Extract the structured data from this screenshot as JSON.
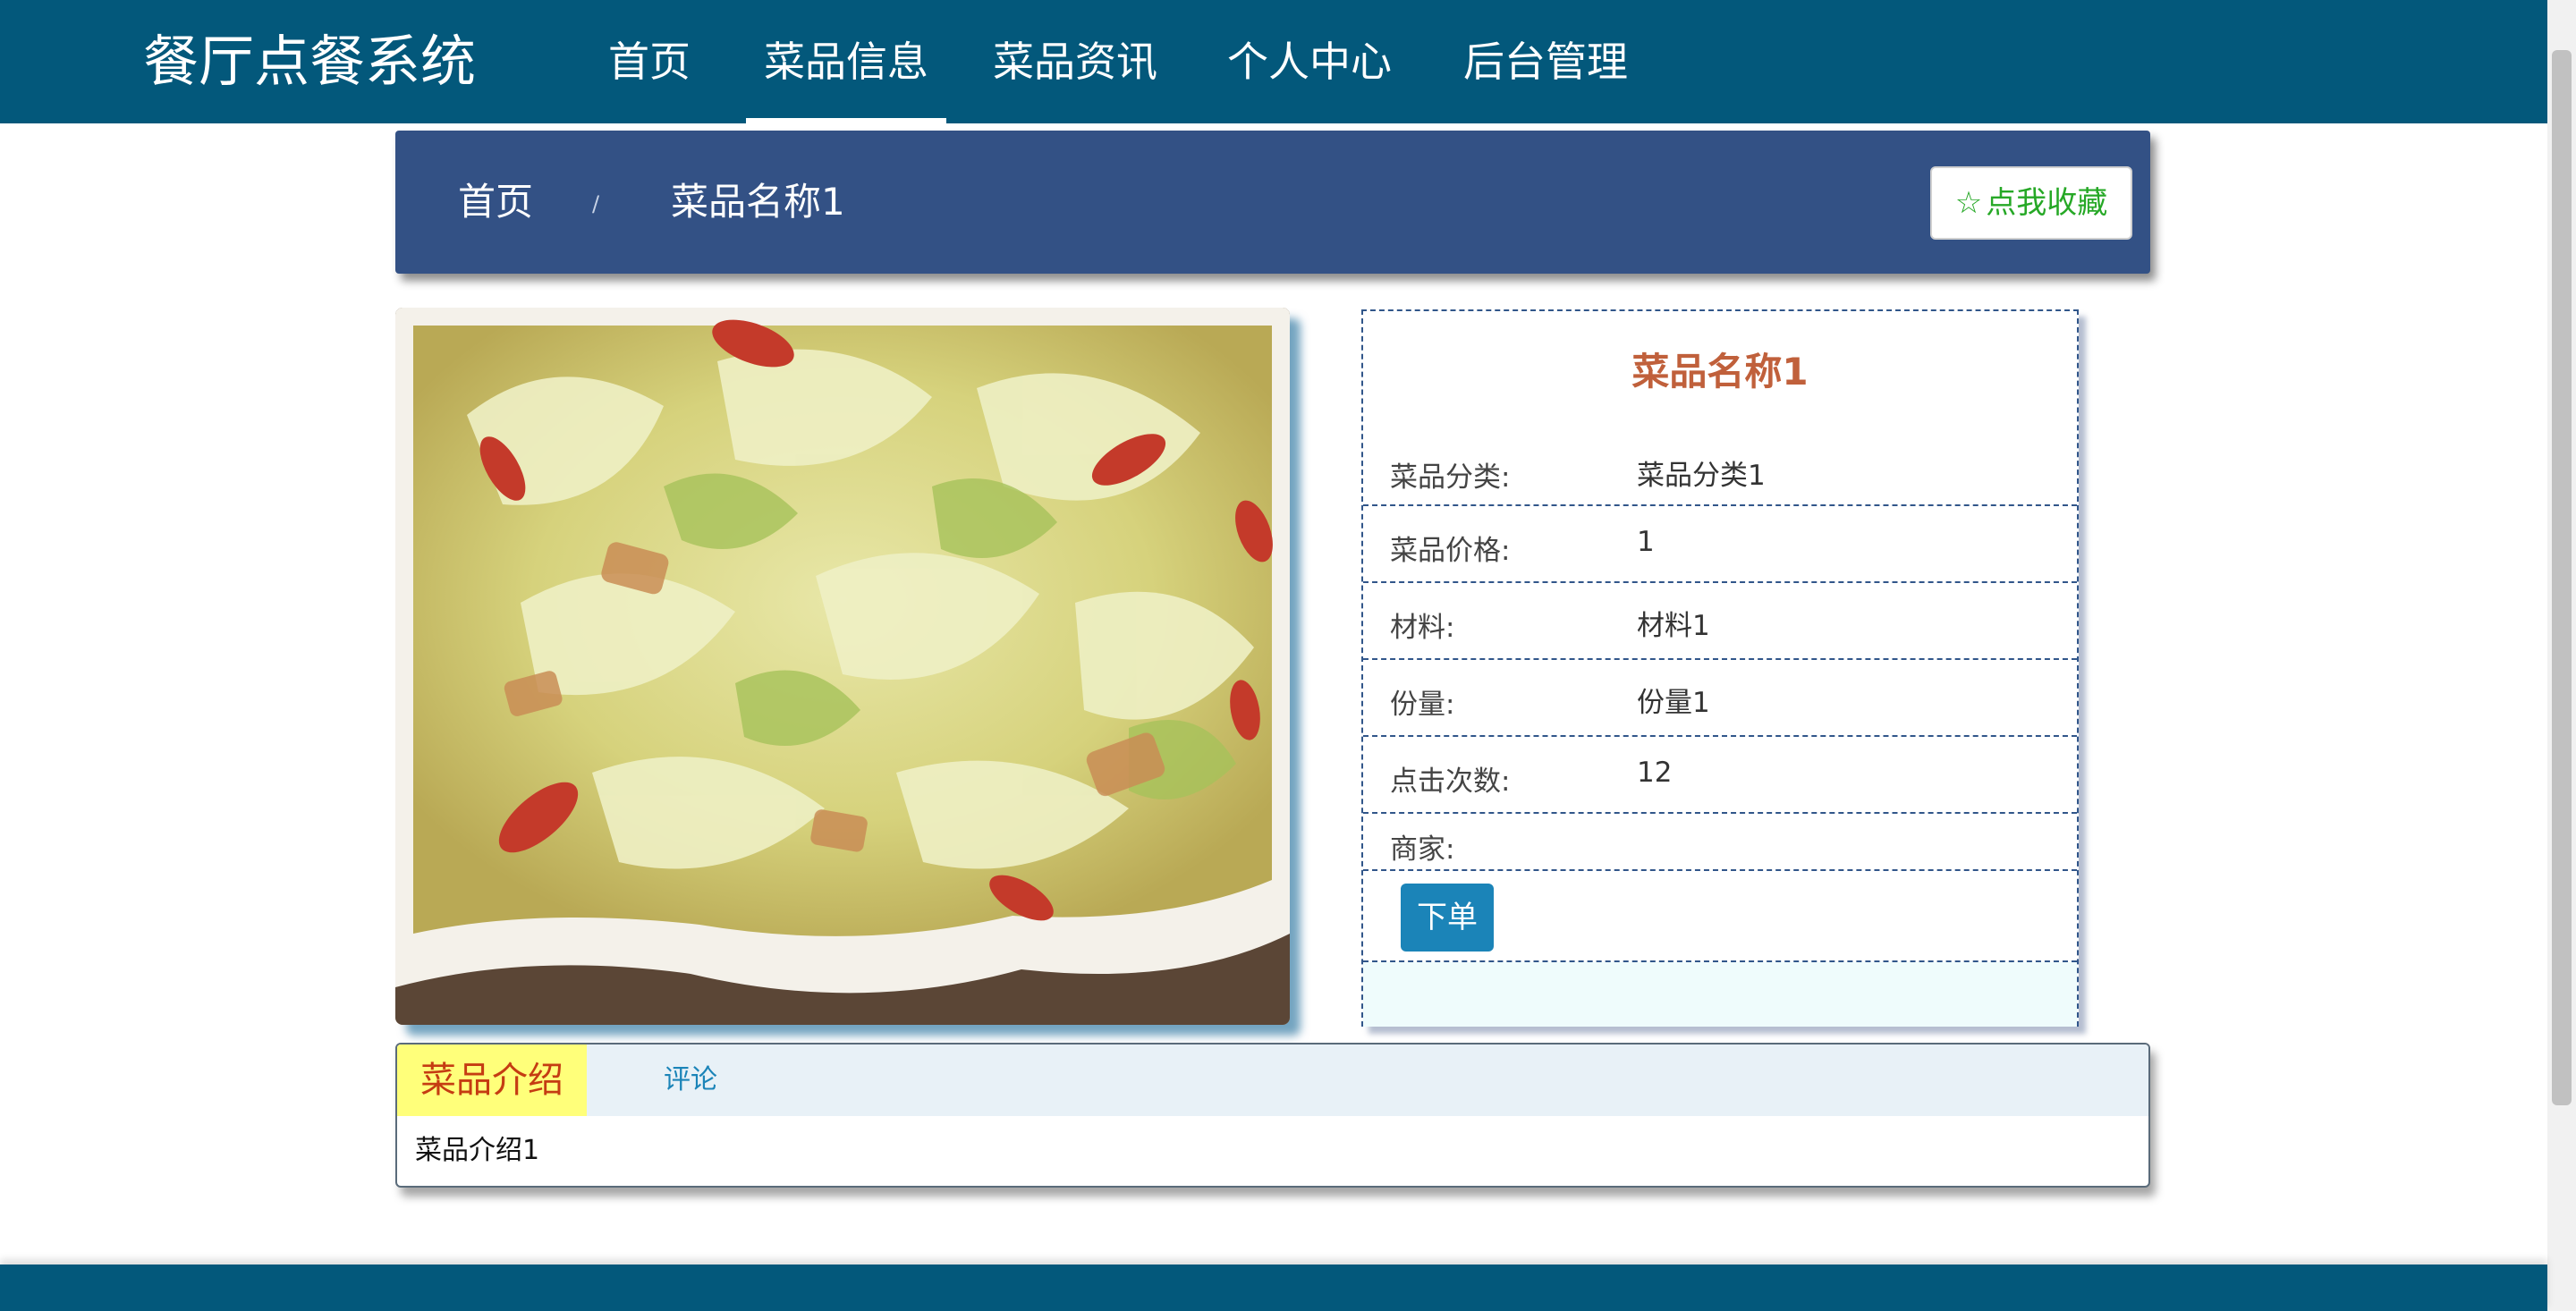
{
  "app": {
    "brand": "餐厅点餐系统"
  },
  "nav": {
    "items": [
      {
        "label": "首页"
      },
      {
        "label": "菜品信息"
      },
      {
        "label": "菜品资讯"
      },
      {
        "label": "个人中心"
      },
      {
        "label": "后台管理"
      }
    ],
    "active": "菜品信息"
  },
  "breadcrumb": {
    "home": "首页",
    "separator": "/",
    "current": "菜品名称1"
  },
  "favorite": {
    "icon": "star-outline-icon",
    "label": "点我收藏"
  },
  "dish": {
    "image_alt_icon": "dish-photo",
    "title": "菜品名称1",
    "fields": [
      {
        "label": "菜品分类:",
        "value": "菜品分类1"
      },
      {
        "label": "菜品价格:",
        "value": "1"
      },
      {
        "label": "材料:",
        "value": "材料1"
      },
      {
        "label": "份量:",
        "value": "份量1"
      },
      {
        "label": "点击次数:",
        "value": "12"
      },
      {
        "label": "商家:",
        "value": ""
      }
    ],
    "order_label": "下单"
  },
  "tabs": {
    "items": [
      {
        "label": "菜品介绍"
      },
      {
        "label": "评论"
      }
    ],
    "active": "菜品介绍",
    "content": "菜品介绍1"
  },
  "colors": {
    "nav_bg": "#03587b",
    "crumb_bg": "#335185",
    "title": "#c0603b",
    "button": "#1b84b8",
    "favorite_text": "#26a826",
    "active_tab_bg": "#ffff7a"
  }
}
